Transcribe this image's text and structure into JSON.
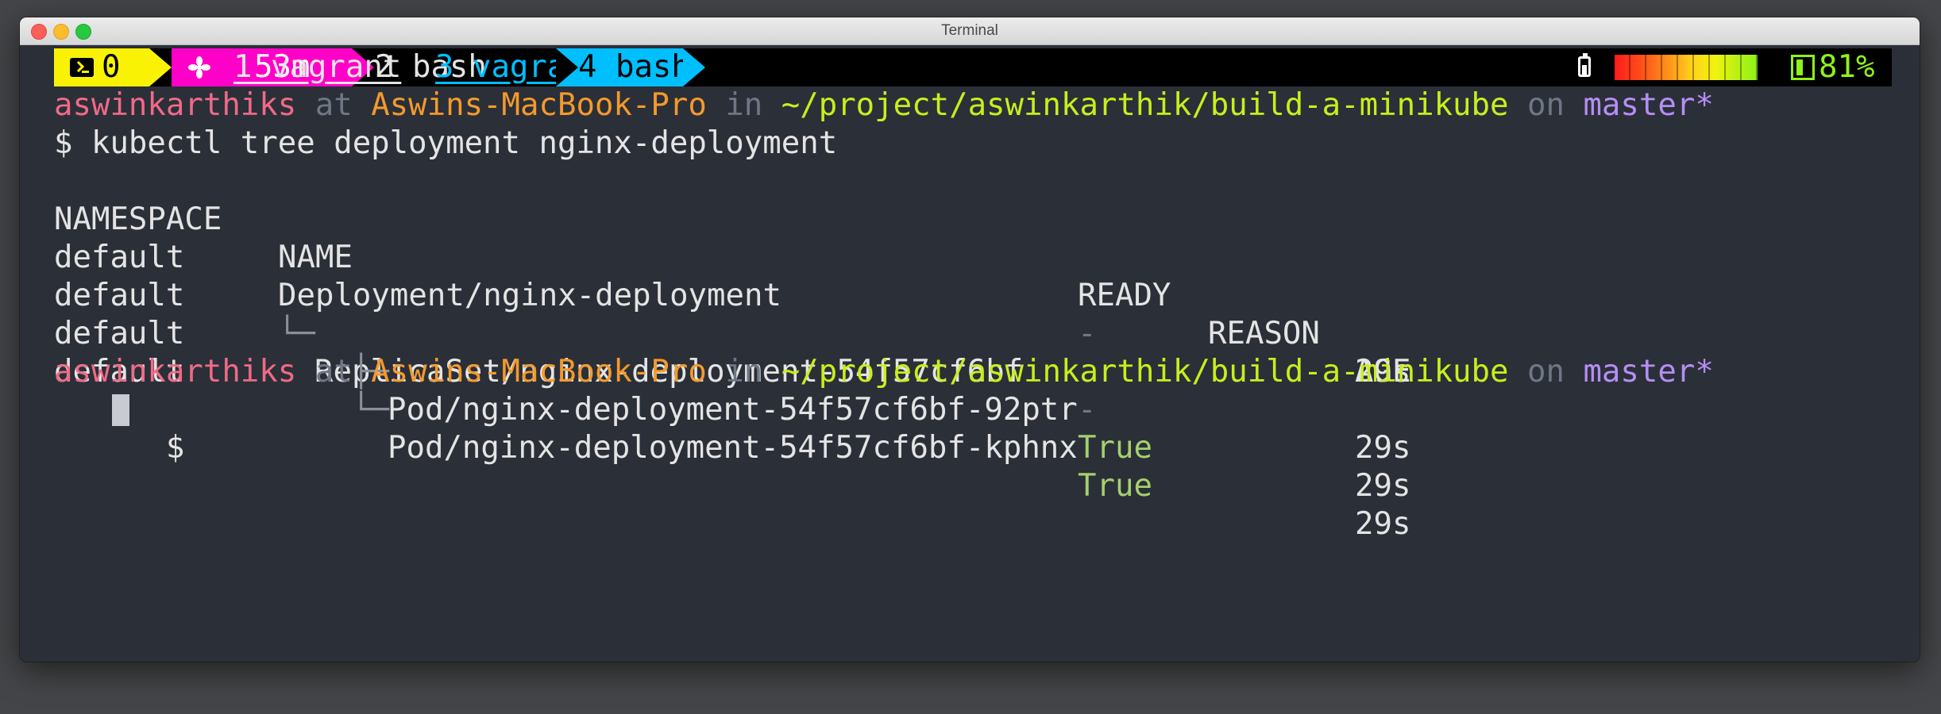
{
  "window": {
    "title": "Terminal"
  },
  "statusbar": {
    "session_number": "0",
    "uptime": "53m",
    "windows": [
      {
        "label": "1 vagrant",
        "state": "underlined"
      },
      {
        "label": "2 bash",
        "state": "normal"
      },
      {
        "label": "3 vagrant",
        "state": "underlined-active"
      },
      {
        "label": "4 bash",
        "state": "current"
      }
    ],
    "battery_percent": "81%",
    "battery_level": 0.81
  },
  "prompt": {
    "user": "aswinkarthiks",
    "at": "at",
    "host": "Aswins-MacBook-Pro",
    "in": "in",
    "path": "~/project/aswinkarthik/build-a-minikube",
    "on": "on",
    "branch": "master*",
    "symbol": "$"
  },
  "command": "kubectl tree deployment nginx-deployment",
  "table": {
    "headers": {
      "namespace": "NAMESPACE",
      "name": "NAME",
      "ready": "READY",
      "reason": "REASON",
      "age": "AGE"
    },
    "rows": [
      {
        "namespace": "default",
        "tree": "",
        "name": "Deployment/nginx-deployment",
        "ready": "-",
        "reason": "",
        "age": "29s"
      },
      {
        "namespace": "default",
        "tree": "└─",
        "name": "ReplicaSet/nginx-deployment-54f57cf6bf",
        "ready": "-",
        "reason": "",
        "age": "29s"
      },
      {
        "namespace": "default",
        "tree": "  ├─",
        "name": "Pod/nginx-deployment-54f57cf6bf-92ptr",
        "ready": "True",
        "reason": "",
        "age": "29s"
      },
      {
        "namespace": "default",
        "tree": "  └─",
        "name": "Pod/nginx-deployment-54f57cf6bf-kphnx",
        "ready": "True",
        "reason": "",
        "age": "29s"
      }
    ]
  },
  "colors": {
    "background": "#2b2f38",
    "user": "#ef6a88",
    "host": "#f39a2c",
    "path": "#c8ee1c",
    "branch": "#b58ef4",
    "ready_true": "#a6cf6d",
    "tmux_yellow": "#f9f205",
    "tmux_magenta": "#ff00c8",
    "tmux_blue": "#00bfff"
  },
  "icons": {
    "session": "terminal-icon",
    "uptime": "fan-icon",
    "battery": "battery-icon"
  }
}
